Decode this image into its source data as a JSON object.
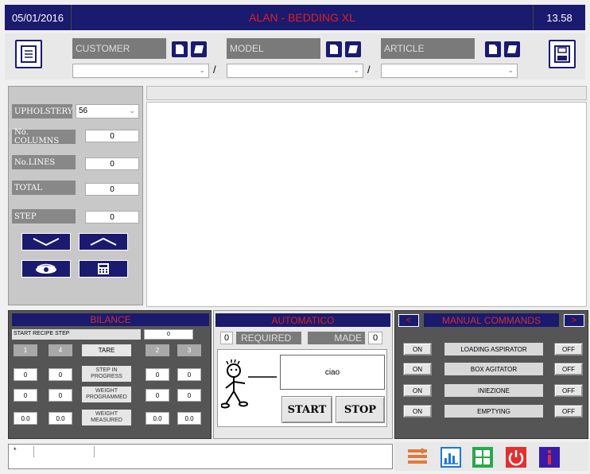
{
  "header": {
    "date": "05/01/2016",
    "title": "ALAN - BEDDING XL",
    "time": "13.58"
  },
  "selectors": {
    "customer_label": "CUSTOMER",
    "model_label": "MODEL",
    "article_label": "ARTICLE",
    "separator": "/"
  },
  "left_panel": {
    "upholstery_label": "UPHOLSTERY",
    "upholstery_value": "56",
    "columns_label": "No. COLUMNS",
    "columns_value": "0",
    "lines_label": "No.LINES",
    "lines_value": "0",
    "total_label": "TOTAL",
    "total_value": "0",
    "step_label": "STEP",
    "step_value": "0"
  },
  "bilance": {
    "title": "BILANCE",
    "start_recipe_label": "START RECIPE STEP",
    "start_recipe_value": "0",
    "btn1": "1",
    "btn4": "4",
    "tare": "TARE",
    "btn2": "2",
    "btn3": "3",
    "step_in_progress": "STEP IN PROGRESS",
    "weight_programmed": "WEIGHT PROGRAMMED",
    "weight_measured": "WEIGHT MEASURED",
    "row_sip": [
      "0",
      "0",
      "0",
      "0"
    ],
    "row_wp": [
      "0",
      "0",
      "0",
      "0"
    ],
    "row_wm": [
      "0.0",
      "0.0",
      "0.0",
      "0.0"
    ]
  },
  "automatico": {
    "title": "AUTOMATICO",
    "required_value": "0",
    "required_label": "REQUIRED",
    "made_label": "MADE",
    "made_value": "0",
    "message": "ciao",
    "start": "START",
    "stop": "STOP"
  },
  "manual": {
    "prev": "<",
    "title": "MANUAL COMMANDS",
    "next": ">",
    "rows": [
      {
        "on": "ON",
        "name": "LOADING ASPIRATOR",
        "off": "OFF"
      },
      {
        "on": "ON",
        "name": "BOX AGITATOR",
        "off": "OFF"
      },
      {
        "on": "ON",
        "name": "INIEZIONE",
        "off": "OFF"
      },
      {
        "on": "ON",
        "name": "EMPTYING",
        "off": "OFF"
      }
    ]
  },
  "status": {
    "cell1": "*"
  },
  "colors": {
    "navy": "#1a1a6e",
    "title_red": "#e02020",
    "bilance_red": "#d03030"
  }
}
